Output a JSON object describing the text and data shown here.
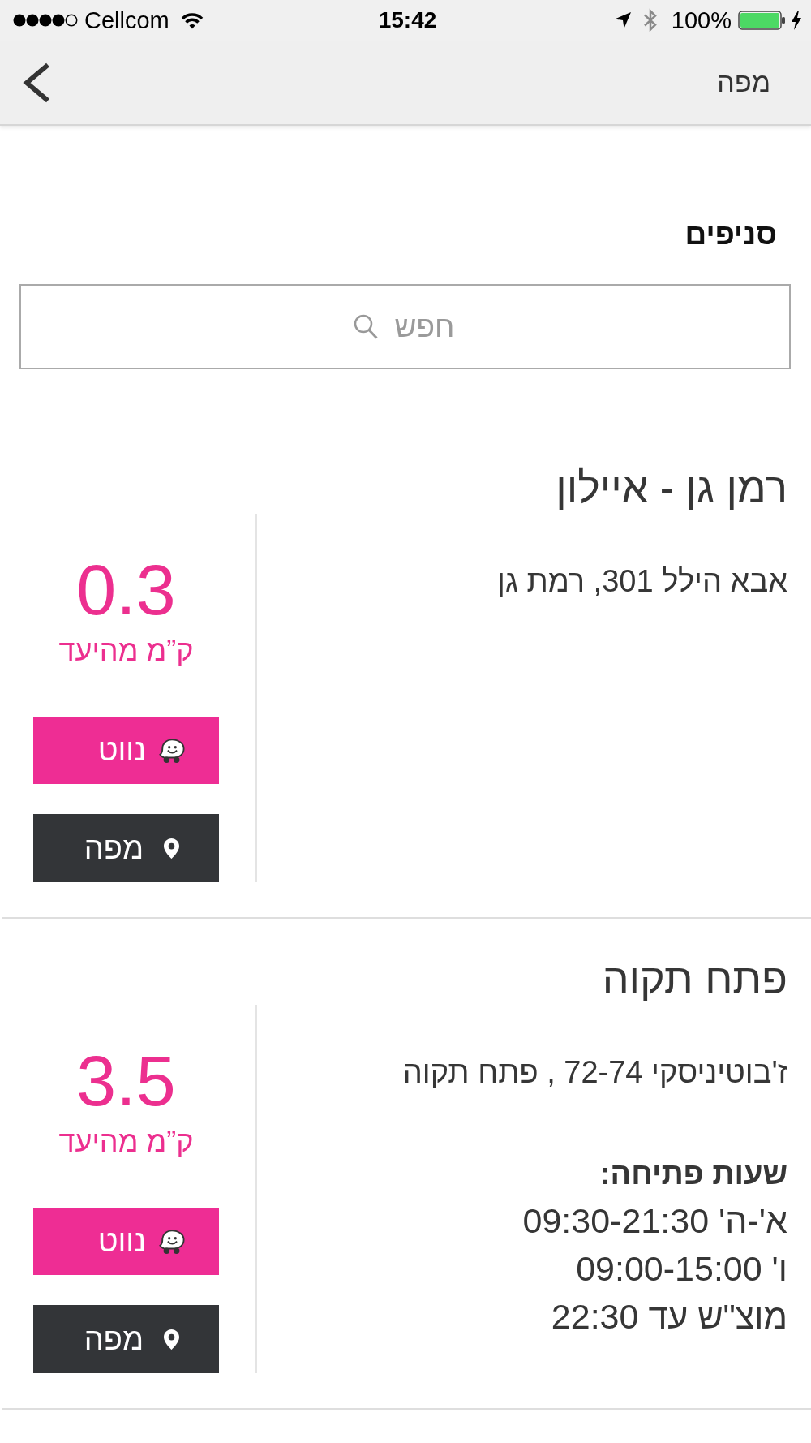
{
  "status_bar": {
    "carrier": "Cellcom",
    "time": "15:42",
    "battery_percent": "100%"
  },
  "nav_bar": {
    "title": "מפה"
  },
  "heading": "סניפים",
  "search": {
    "placeholder": "חפש"
  },
  "branches": [
    {
      "name": "רמן גן - איילון",
      "address": "אבא הילל 301, רמת גן",
      "distance": "0.3",
      "distance_label": "ק”מ מהיעד",
      "buttons": [
        {
          "kind": "navigate",
          "label": "נווט"
        },
        {
          "kind": "map",
          "label": "מפה"
        }
      ]
    },
    {
      "name": "פתח תקוה",
      "address": "ז'בוטיניסקי 72-74 , פתח תקוה",
      "hours": {
        "title": "שעות פתיחה:",
        "lines": [
          "א'-ה' 09:30-21:30",
          "ו' 09:00-15:00",
          "מוצ\"ש עד 22:30"
        ]
      },
      "distance": "3.5",
      "distance_label": "ק”מ מהיעד",
      "buttons": [
        {
          "kind": "navigate",
          "label": "נווט"
        },
        {
          "kind": "map",
          "label": "מפה"
        }
      ]
    }
  ]
}
